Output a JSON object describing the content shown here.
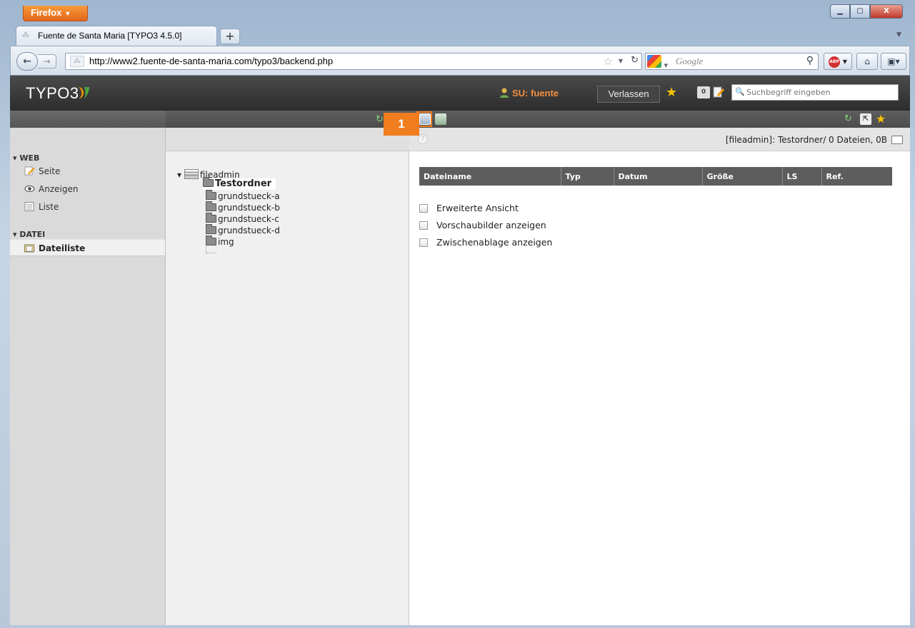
{
  "browser": {
    "menu_button": "Firefox",
    "tab_title": "Fuente de Santa Maria [TYPO3 4.5.0]",
    "new_tab": "+",
    "url": "http://www2.fuente-de-santa-maria.com/typo3/backend.php",
    "search_placeholder": "Google"
  },
  "topbar": {
    "logo": "TYPO3",
    "user": "SU: fuente",
    "logout_label": "Verlassen",
    "workspace_badge": "0",
    "search_placeholder": "Suchbegriff eingeben"
  },
  "step_marker": "1",
  "menu": {
    "groups": [
      {
        "label": "▾ WEB",
        "items": [
          "Seite",
          "Anzeigen",
          "Liste"
        ]
      },
      {
        "label": "▾ DATEI",
        "items": [
          "Dateiliste"
        ]
      }
    ],
    "active_item": "Dateiliste"
  },
  "tree": {
    "root": "fileadmin",
    "selected": "Testordner",
    "children": [
      "grundstueck-a",
      "grundstueck-b",
      "grundstueck-c",
      "grundstueck-d",
      "img"
    ]
  },
  "content": {
    "path_info": "[fileadmin]: Testordner/ 0 Dateien, 0B",
    "columns": [
      "Dateiname",
      "Typ",
      "Datum",
      "Größe",
      "LS",
      "Ref."
    ],
    "options": [
      "Erweiterte Ansicht",
      "Vorschaubilder anzeigen",
      "Zwischenablage anzeigen"
    ]
  },
  "colors": {
    "accent_orange": "#f07d1e",
    "topbar_dark": "#333333",
    "table_header": "#5d5d5d"
  }
}
